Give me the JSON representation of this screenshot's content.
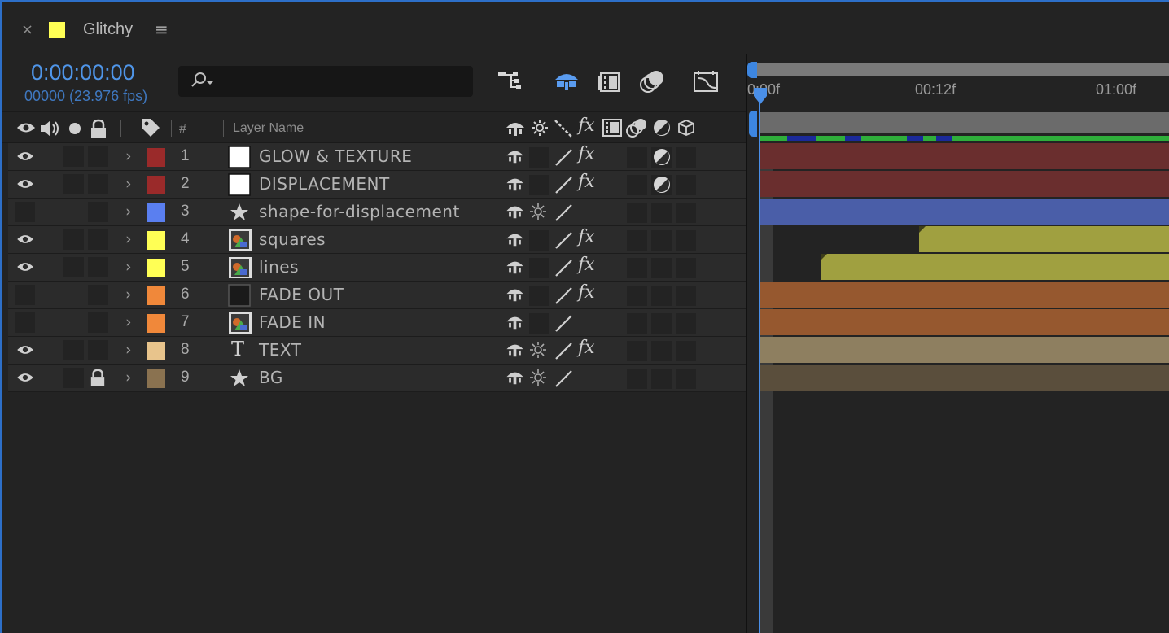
{
  "tab": {
    "close_glyph": "×",
    "title": "Glitchy",
    "color": "#ffff55",
    "menu_glyph": "≡"
  },
  "time": {
    "timecode": "0:00:00:00",
    "frames_fps": "00000 (23.976 fps)"
  },
  "search": {
    "icon": "search-icon"
  },
  "toolbar": {
    "icons": [
      "composition-flowchart-icon",
      "draft-3d-icon",
      "frame-blending-icon",
      "motion-blur-icon",
      "graph-editor-icon"
    ]
  },
  "columns": {
    "av_icons": [
      "video-eye-icon",
      "audio-speaker-icon",
      "solo-dot-icon",
      "lock-icon"
    ],
    "label_icon": "label-tag-icon",
    "number": "#",
    "layer_name": "Layer Name",
    "switch_icons": [
      "shy-icon",
      "collapse-icon",
      "quality-icon",
      "effects-icon",
      "frame-blend-icon",
      "motion-blur-icon",
      "adjustment-icon",
      "3d-layer-icon"
    ]
  },
  "layers": [
    {
      "num": "1",
      "name": "GLOW & TEXTURE",
      "label_color": "#9a2a2a",
      "source": "solid-white",
      "visible": true,
      "locked": false,
      "collapse": false,
      "fx": true,
      "adjustment": true,
      "bar_color": "#6a2e2e",
      "bar_start": 0
    },
    {
      "num": "2",
      "name": "DISPLACEMENT",
      "label_color": "#9a2a2a",
      "source": "solid-white",
      "visible": true,
      "locked": false,
      "collapse": false,
      "fx": true,
      "adjustment": true,
      "bar_color": "#6a2e2e",
      "bar_start": 0
    },
    {
      "num": "3",
      "name": "shape-for-displacement",
      "label_color": "#5a7ff0",
      "source": "shape-star",
      "visible": false,
      "locked": false,
      "collapse": true,
      "fx": false,
      "adjustment": false,
      "bar_color": "#4a5ea8",
      "bar_start": 0
    },
    {
      "num": "4",
      "name": "squares",
      "label_color": "#ffff55",
      "source": "precomp",
      "visible": true,
      "locked": false,
      "collapse": false,
      "fx": true,
      "adjustment": false,
      "bar_color": "#a0a040",
      "bar_start": 0.39
    },
    {
      "num": "5",
      "name": "lines",
      "label_color": "#ffff55",
      "source": "precomp",
      "visible": true,
      "locked": false,
      "collapse": false,
      "fx": true,
      "adjustment": false,
      "bar_color": "#a0a040",
      "bar_start": 0.15
    },
    {
      "num": "6",
      "name": "FADE OUT",
      "label_color": "#f0883a",
      "source": "solid-black",
      "visible": false,
      "locked": false,
      "collapse": false,
      "fx": true,
      "adjustment": false,
      "bar_color": "#96582f",
      "bar_start": 0
    },
    {
      "num": "7",
      "name": "FADE IN",
      "label_color": "#f0883a",
      "source": "precomp",
      "visible": false,
      "locked": false,
      "collapse": false,
      "fx": false,
      "adjustment": false,
      "bar_color": "#96582f",
      "bar_start": 0
    },
    {
      "num": "8",
      "name": "TEXT",
      "label_color": "#e8c48c",
      "source": "text",
      "visible": true,
      "locked": false,
      "collapse": true,
      "fx": true,
      "adjustment": false,
      "bar_color": "#8e7f60",
      "bar_start": 0
    },
    {
      "num": "9",
      "name": "BG",
      "label_color": "#8a7250",
      "source": "shape-star",
      "visible": true,
      "locked": true,
      "collapse": true,
      "fx": false,
      "adjustment": false,
      "bar_color": "#5a4e3c",
      "bar_start": 0
    }
  ],
  "timeline": {
    "ruler_labels": [
      "0:00f",
      "00:12f",
      "01:00f"
    ],
    "cache_segments": [
      {
        "start": 0.07,
        "end": 0.14
      },
      {
        "start": 0.21,
        "end": 0.25
      },
      {
        "start": 0.36,
        "end": 0.4
      },
      {
        "start": 0.43,
        "end": 0.47
      }
    ],
    "accent": "#3d86e0"
  }
}
